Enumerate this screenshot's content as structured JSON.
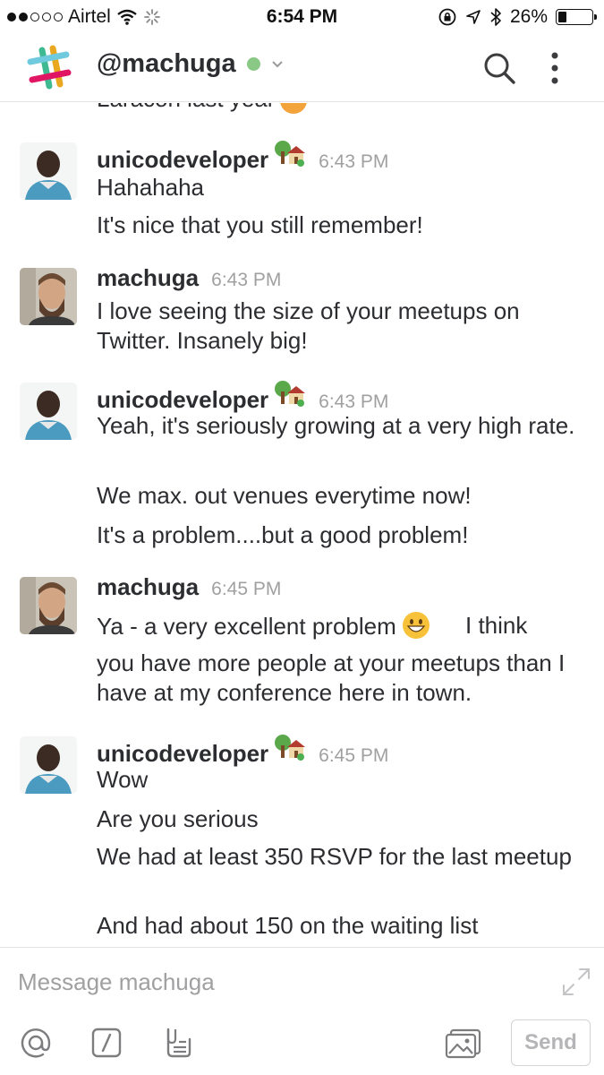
{
  "status_bar": {
    "carrier": "Airtel",
    "time": "6:54 PM",
    "battery": "26%",
    "battery_level": 0.26
  },
  "header": {
    "channel": "@machuga",
    "presence": "online",
    "presence_color": "#8ac886",
    "icons": [
      "slack-logo-icon",
      "search-icon",
      "more-vertical-icon"
    ]
  },
  "messages": {
    "cut_text": "Laracon last year",
    "items": [
      {
        "sender": "unicodeveloper",
        "time": "6:43 PM",
        "status_icon": "house-with-garden-icon",
        "lines": [
          "Hahahaha",
          "It's nice that you still remember!"
        ]
      },
      {
        "sender": "machuga",
        "time": "6:43 PM",
        "lines": [
          "I love seeing the size of your meetups on Twitter. Insanely big!"
        ]
      },
      {
        "sender": "unicodeveloper",
        "time": "6:43 PM",
        "status_icon": "house-with-garden-icon",
        "lines": [
          "Yeah, it's seriously growing at a very high rate.",
          "We max. out venues everytime now!",
          "It's a problem....but a good problem!"
        ]
      },
      {
        "sender": "machuga",
        "time": "6:45 PM",
        "lines": [
          "Ya - a very excellent problem",
          "I think you have more people at your meetups than I have at my conference here in town."
        ]
      },
      {
        "sender": "unicodeveloper",
        "time": "6:45 PM",
        "status_icon": "house-with-garden-icon",
        "lines": [
          "Wow",
          "Are you serious",
          "We had at least 350 RSVP for the last meetup",
          "And had about 150 on the waiting list"
        ]
      }
    ]
  },
  "composer": {
    "placeholder": "Message machuga",
    "send_label": "Send",
    "tools": [
      "at-mention-icon",
      "slash-command-icon",
      "file-icon",
      "photo-icon",
      "expand-icon"
    ]
  }
}
